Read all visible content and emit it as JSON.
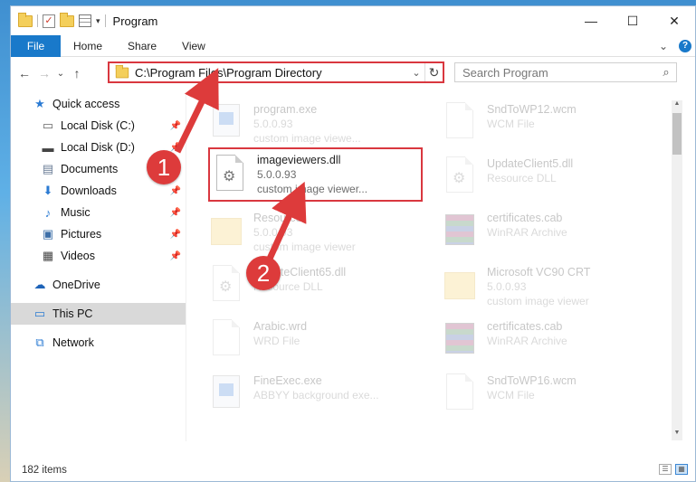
{
  "window": {
    "title": "Program",
    "controls": {
      "minimize": "—",
      "maximize": "☐",
      "close": "✕"
    }
  },
  "quick_access_toolbar": {
    "dropdown": "▾"
  },
  "ribbon": {
    "tabs": [
      "File",
      "Home",
      "Share",
      "View"
    ],
    "expand": "⌄",
    "help": "?"
  },
  "nav": {
    "back": "←",
    "forward": "→",
    "recent": "⌄",
    "up": "↑",
    "address": "C:\\Program Files\\Program Directory",
    "address_dropdown": "⌄",
    "refresh": "↻",
    "search_placeholder": "Search Program",
    "search_icon": "⌕"
  },
  "sidebar": {
    "items": [
      {
        "label": "Quick access",
        "icon": "star-icon"
      },
      {
        "label": "Local Disk (C:)",
        "icon": "drive-icon",
        "pinned": true
      },
      {
        "label": "Local Disk (D:)",
        "icon": "drive-icon",
        "pinned": true
      },
      {
        "label": "Documents",
        "icon": "documents-icon",
        "pinned": true
      },
      {
        "label": "Downloads",
        "icon": "download-icon",
        "pinned": true
      },
      {
        "label": "Music",
        "icon": "music-icon",
        "pinned": true
      },
      {
        "label": "Pictures",
        "icon": "pictures-icon",
        "pinned": true
      },
      {
        "label": "Videos",
        "icon": "videos-icon",
        "pinned": true
      },
      {
        "label": "OneDrive",
        "icon": "cloud-icon"
      },
      {
        "label": "This PC",
        "icon": "computer-icon",
        "selected": true
      },
      {
        "label": "Network",
        "icon": "network-icon"
      }
    ]
  },
  "files": {
    "left": [
      {
        "name": "program.exe",
        "version": "5.0.0.93",
        "desc": "custom image viewe..."
      },
      {
        "name": "imageviewers.dll",
        "version": "5.0.0.93",
        "desc": "custom image viewer..."
      },
      {
        "name": "Resource",
        "version": "5.0.0.93",
        "desc": "custom image viewer"
      },
      {
        "name": "UpdateClient65.dll",
        "version": "Resource DLL",
        "desc": ""
      },
      {
        "name": "Arabic.wrd",
        "version": "WRD File",
        "desc": ""
      },
      {
        "name": "FineExec.exe",
        "version": "ABBYY background exe...",
        "desc": ""
      }
    ],
    "right": [
      {
        "name": "SndToWP12.wcm",
        "version": "WCM File",
        "desc": ""
      },
      {
        "name": "UpdateClient5.dll",
        "version": "Resource DLL",
        "desc": ""
      },
      {
        "name": "certificates.cab",
        "version": "WinRAR Archive",
        "desc": ""
      },
      {
        "name": "Microsoft VC90 CRT",
        "version": "5.0.0.93",
        "desc": "custom image viewer"
      },
      {
        "name": "certificates.cab",
        "version": "WinRAR Archive",
        "desc": ""
      },
      {
        "name": "SndToWP16.wcm",
        "version": "WCM File",
        "desc": ""
      }
    ]
  },
  "annotations": {
    "step1": "1",
    "step2": "2",
    "accent_color": "#dd3b3b"
  },
  "status": {
    "item_count": "182 items"
  }
}
